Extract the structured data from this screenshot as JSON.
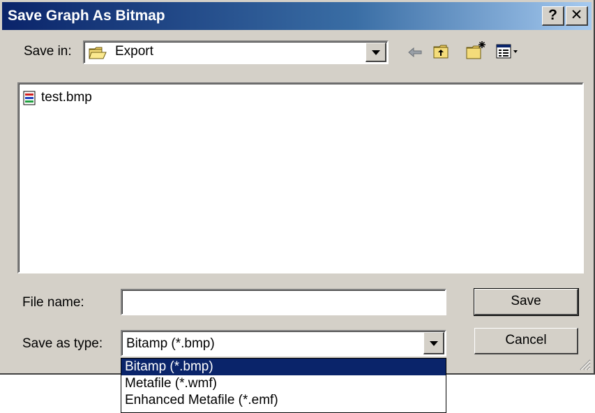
{
  "window": {
    "title": "Save Graph As Bitmap",
    "help_label": "?",
    "close_label": "✕"
  },
  "save_in": {
    "label": "Save in:",
    "value": "Export"
  },
  "files": [
    {
      "name": "test.bmp"
    }
  ],
  "filename": {
    "label": "File name:",
    "value": ""
  },
  "save_as_type": {
    "label": "Save as type:",
    "value": "Bitamp (*.bmp)",
    "options": [
      "Bitamp (*.bmp)",
      "Metafile (*.wmf)",
      "Enhanced Metafile (*.emf)"
    ],
    "selected_index": 0
  },
  "buttons": {
    "save": "Save",
    "cancel": "Cancel"
  },
  "colors": {
    "title_start": "#0a246a",
    "title_end": "#a6caf0",
    "face": "#d4d0c8",
    "selection": "#0a246a"
  }
}
